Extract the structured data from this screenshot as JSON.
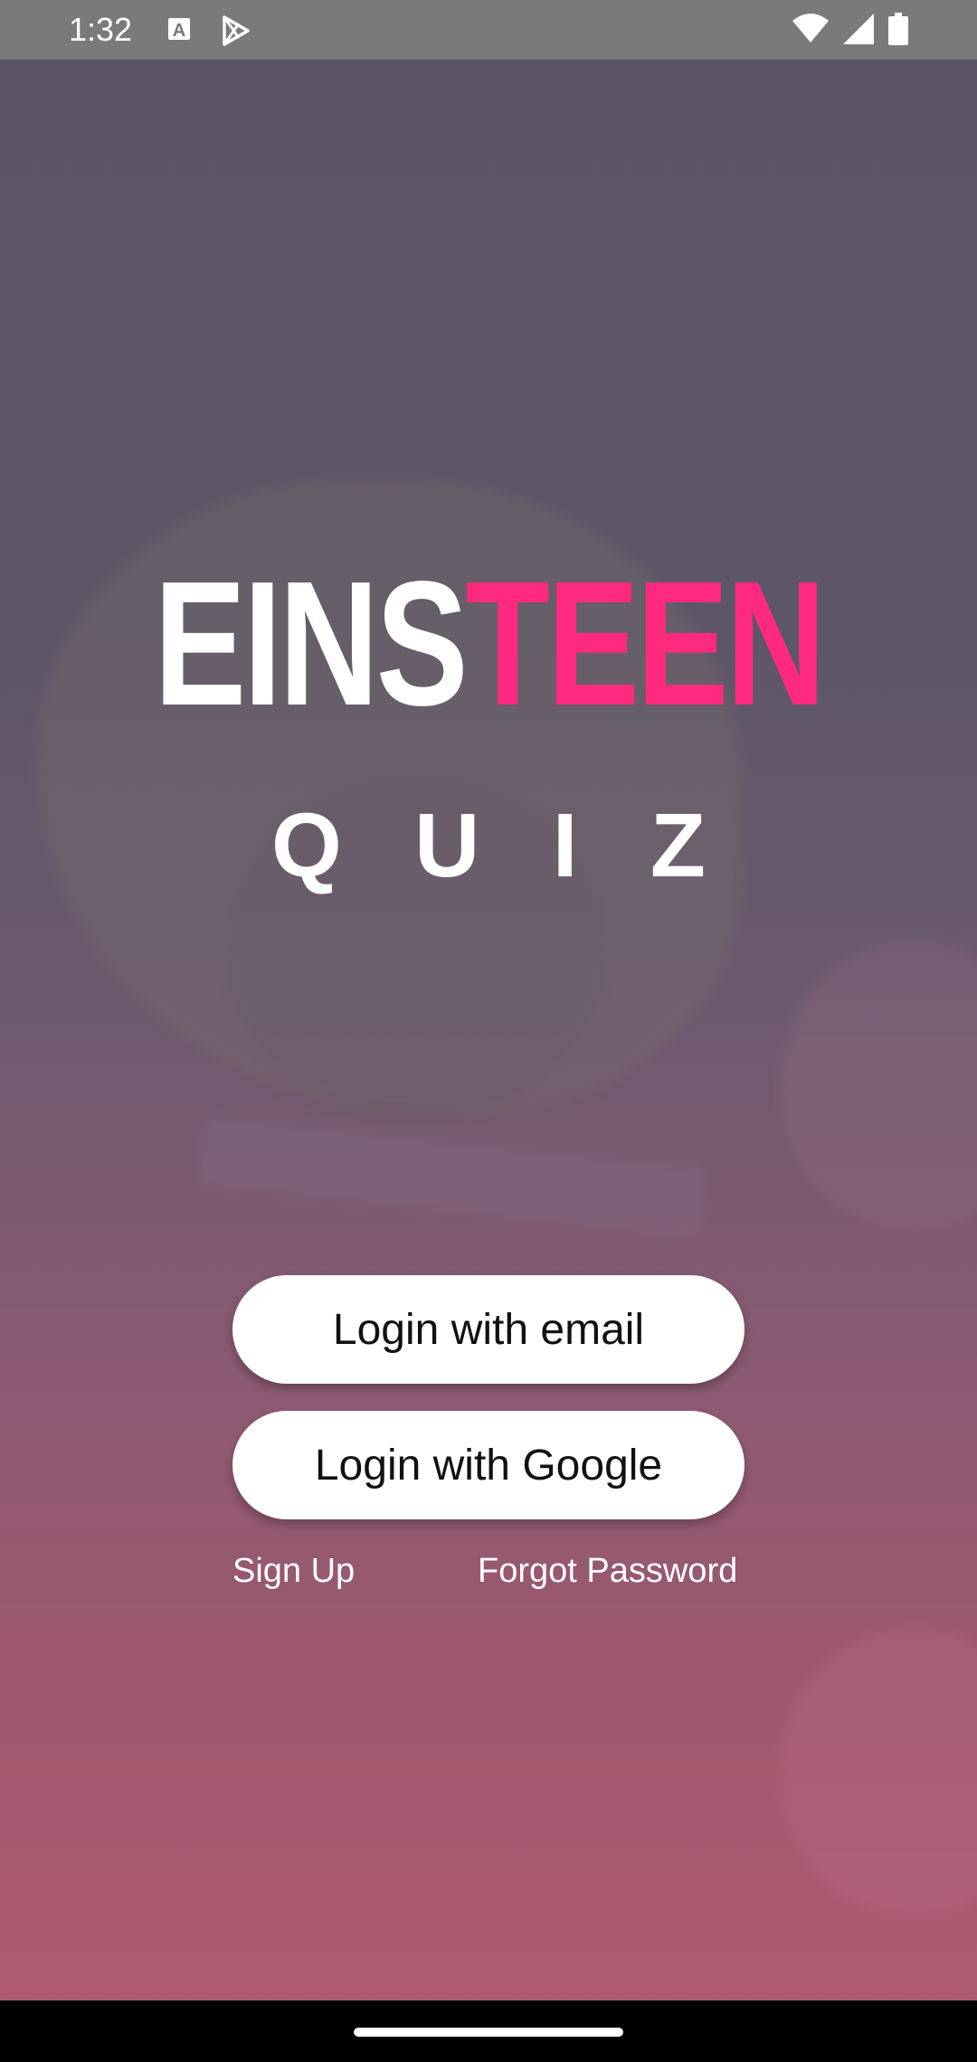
{
  "status_bar": {
    "time": "1:32",
    "icons": [
      "text-a-icon",
      "play-store-icon",
      "wifi-icon",
      "signal-icon",
      "battery-icon"
    ]
  },
  "logo": {
    "part1": "EINS",
    "part2": "TEEN",
    "subtitle_letters": [
      "Q",
      "U",
      "I",
      "Z"
    ],
    "colors": {
      "part1": "#ffffff",
      "part2": "#ff2a7f"
    }
  },
  "actions": {
    "login_email": "Login with email",
    "login_google": "Login with Google",
    "sign_up": "Sign Up",
    "forgot_password": "Forgot Password"
  }
}
